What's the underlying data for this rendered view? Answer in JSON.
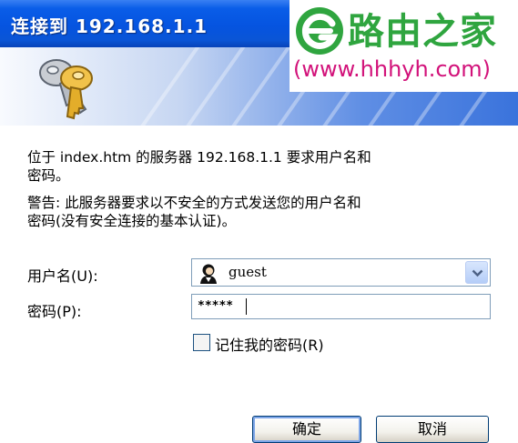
{
  "window": {
    "title": "连接到 192.168.1.1"
  },
  "dialog": {
    "message1": "位于 index.htm 的服务器 192.168.1.1 要求用户名和",
    "message1b": "密码。",
    "message2": "警告: 此服务器要求以不安全的方式发送您的用户名和",
    "message2b": "密码(没有安全连接的基本认证)。",
    "username_label": "用户名(U):",
    "username_value": "guest",
    "password_label": "密码(P):",
    "password_value": "*****",
    "remember_label": "记住我的密码(R)",
    "remember_checked": false,
    "ok_label": "确定",
    "cancel_label": "取消"
  },
  "watermark": {
    "name": "路由之家",
    "url": "(www.hhhyh.com)"
  },
  "colors": {
    "titlebar": "#0554e0",
    "watermark_green": "#2fa53f",
    "watermark_pink": "#d2127a"
  },
  "icons": [
    "keys-icon",
    "user-icon",
    "chevron-down-icon",
    "help-icon",
    "close-icon",
    "router-logo-icon"
  ]
}
